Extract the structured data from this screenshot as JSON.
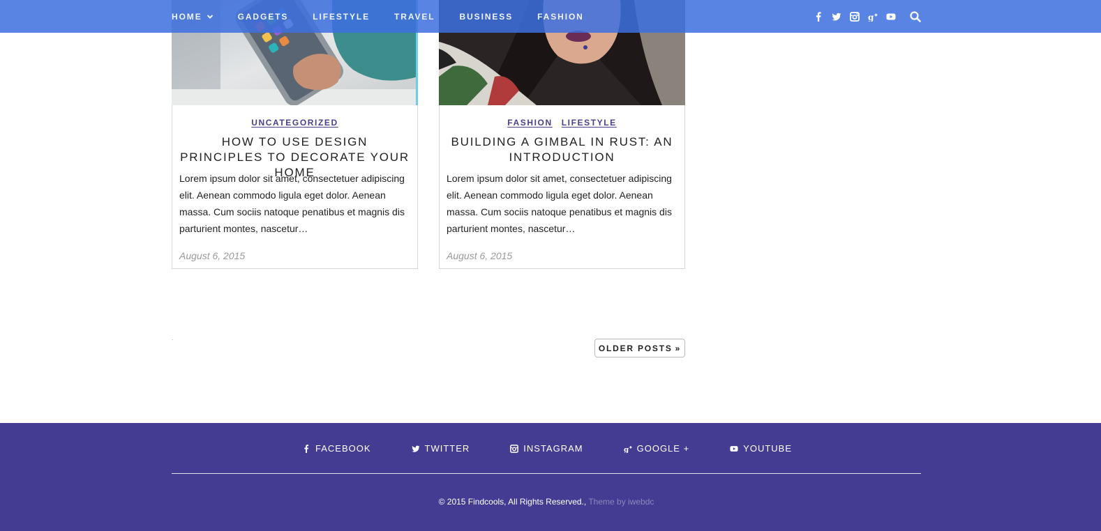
{
  "nav": {
    "menu": [
      {
        "label": "HOME",
        "has_dropdown": true
      },
      {
        "label": "GADGETS"
      },
      {
        "label": "LIFESTYLE"
      },
      {
        "label": "TRAVEL"
      },
      {
        "label": "BUSINESS"
      },
      {
        "label": "FASHION"
      }
    ],
    "social_icons": [
      "facebook-icon",
      "twitter-icon",
      "instagram-icon",
      "google-plus-icon",
      "youtube-icon"
    ],
    "search_icon": "search-icon",
    "bar_color": "#3e70de"
  },
  "posts": [
    {
      "categories": [
        "UNCATEGORIZED"
      ],
      "title": "HOW TO USE DESIGN PRINCIPLES TO DECORATE YOUR HOME",
      "excerpt": "Lorem ipsum dolor sit amet, consectetuer adipiscing elit. Aenean commodo ligula eget dolor. Aenean massa. Cum sociis natoque penatibus et magnis dis parturient montes, nascetur…",
      "date": "August 6, 2015"
    },
    {
      "categories": [
        "FASHION",
        "LIFESTYLE"
      ],
      "title": "BUILDING A GIMBAL IN RUST: AN INTRODUCTION",
      "excerpt": "Lorem ipsum dolor sit amet, consectetuer adipiscing elit. Aenean commodo ligula eget dolor. Aenean massa. Cum sociis natoque penatibus et magnis dis parturient montes, nascetur…",
      "date": "August 6, 2015"
    }
  ],
  "pagination": {
    "marker": ".",
    "older_label": "OLDER POSTS",
    "older_icon": "double-chevron-right-icon"
  },
  "footer": {
    "links": [
      {
        "label": "FACEBOOK",
        "icon": "facebook-icon"
      },
      {
        "label": "TWITTER",
        "icon": "twitter-icon"
      },
      {
        "label": "INSTAGRAM",
        "icon": "instagram-icon"
      },
      {
        "label": "GOOGLE +",
        "icon": "google-plus-icon"
      },
      {
        "label": "YOUTUBE",
        "icon": "youtube-icon"
      }
    ],
    "copyright": "© 2015 Findcools, All Rights Reserved.,",
    "theme_credit": "Theme by iwebdc",
    "bg_color": "#443c92",
    "category_link_color": "#4a3f8e"
  }
}
